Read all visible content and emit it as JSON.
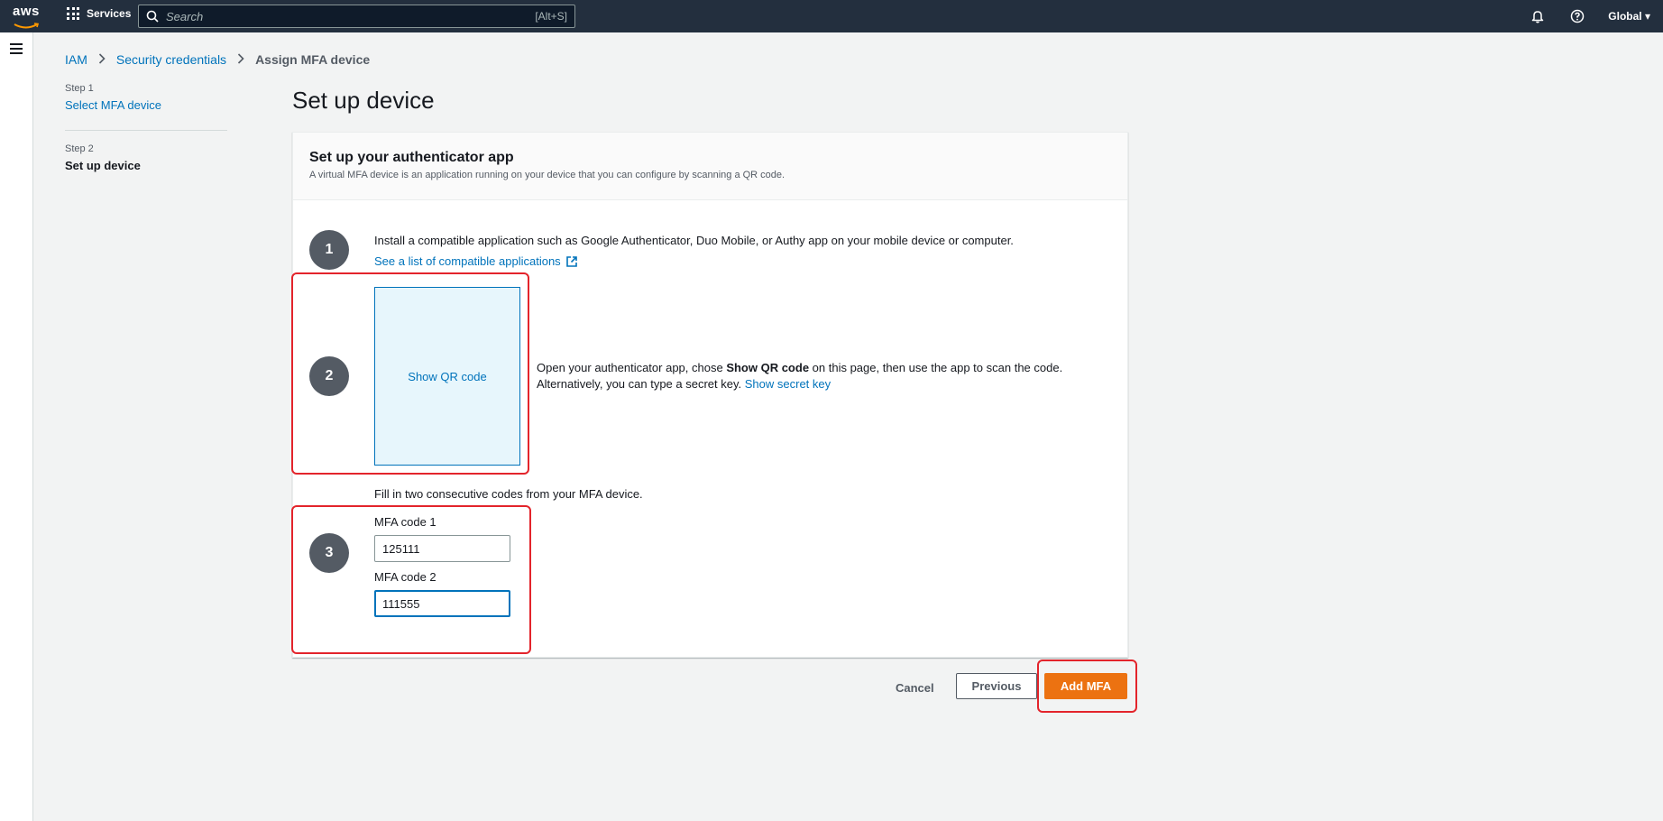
{
  "topnav": {
    "logo_text": "aws",
    "services_label": "Services",
    "search_placeholder": "Search",
    "search_shortcut": "[Alt+S]",
    "region_label": "Global ▾"
  },
  "breadcrumb": {
    "items": [
      "IAM",
      "Security credentials"
    ],
    "current": "Assign MFA device"
  },
  "steps": [
    {
      "step_label": "Step 1",
      "name": "Select MFA device"
    },
    {
      "step_label": "Step 2",
      "name": "Set up device"
    }
  ],
  "page_title": "Set up device",
  "panel": {
    "title": "Set up your authenticator app",
    "description": "A virtual MFA device is an application running on your device that you can configure by scanning a QR code."
  },
  "step1": {
    "number": "1",
    "text": "Install a compatible application such as Google Authenticator, Duo Mobile, or Authy app on your mobile device or computer.",
    "link": "See a list of compatible applications"
  },
  "step2": {
    "number": "2",
    "qr_label": "Show QR code",
    "text_before": "Open your authenticator app, chose ",
    "text_bold": "Show QR code",
    "text_after": " on this page, then use the app to scan the code.",
    "line2": "Alternatively, you can type a secret key. ",
    "secret_link": "Show secret key"
  },
  "step3": {
    "number": "3",
    "intro": "Fill in two consecutive codes from your MFA device.",
    "code1_label": "MFA code 1",
    "code1_value": "125111",
    "code2_label": "MFA code 2",
    "code2_value": "111555"
  },
  "footer": {
    "cancel": "Cancel",
    "previous": "Previous",
    "add": "Add MFA"
  },
  "colors": {
    "nav_bg": "#232f3e",
    "link": "#0073bb",
    "primary_button": "#ec7211",
    "highlight": "#e3242b",
    "step_circle": "#545b64"
  }
}
